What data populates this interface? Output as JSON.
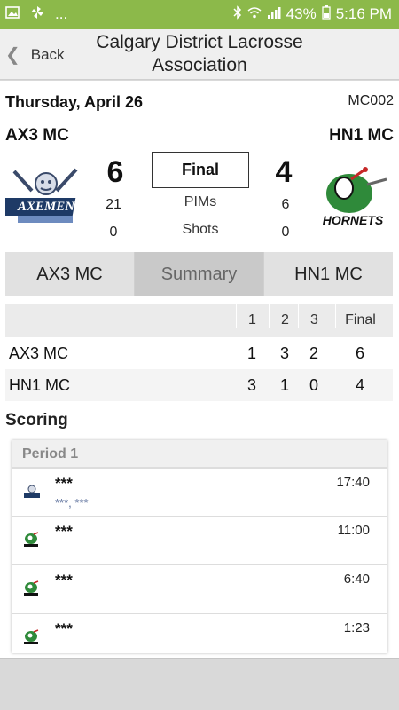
{
  "status_bar": {
    "battery_percent": "43%",
    "time": "5:16 PM",
    "overflow": "..."
  },
  "header": {
    "back_label": "Back",
    "title": "Calgary District Lacrosse Association"
  },
  "game": {
    "date": "Thursday, April 26",
    "code": "MC002",
    "home_team": "AX3 MC",
    "away_team": "HN1 MC",
    "home_score": "6",
    "away_score": "4",
    "status": "Final",
    "home_pims": "21",
    "away_pims": "6",
    "home_shots": "0",
    "away_shots": "0",
    "pims_label": "PIMs",
    "shots_label": "Shots"
  },
  "tabs": [
    {
      "label": "AX3 MC"
    },
    {
      "label": "Summary"
    },
    {
      "label": "HN1 MC"
    }
  ],
  "period_table": {
    "headers": [
      "1",
      "2",
      "3",
      "Final"
    ],
    "rows": [
      {
        "team": "AX3 MC",
        "p1": "1",
        "p2": "3",
        "p3": "2",
        "final": "6"
      },
      {
        "team": "HN1 MC",
        "p1": "3",
        "p2": "1",
        "p3": "0",
        "final": "4"
      }
    ]
  },
  "scoring": {
    "title": "Scoring",
    "periods": [
      {
        "label": "Period 1",
        "goals": [
          {
            "team": "AX3",
            "scorer": "***",
            "assists": "***, ***",
            "time": "17:40"
          },
          {
            "team": "HN1",
            "scorer": "***",
            "assists": "",
            "time": "11:00"
          },
          {
            "team": "HN1",
            "scorer": "***",
            "assists": "",
            "time": "6:40"
          },
          {
            "team": "HN1",
            "scorer": "***",
            "assists": "",
            "time": "1:23"
          }
        ]
      }
    ]
  },
  "logos": {
    "home": "AXEMEN",
    "away": "HORNETS"
  },
  "colors": {
    "status_bar": "#8cb94a",
    "active_tab": "#c9c9c9",
    "assist_text": "#5a6e9a"
  }
}
